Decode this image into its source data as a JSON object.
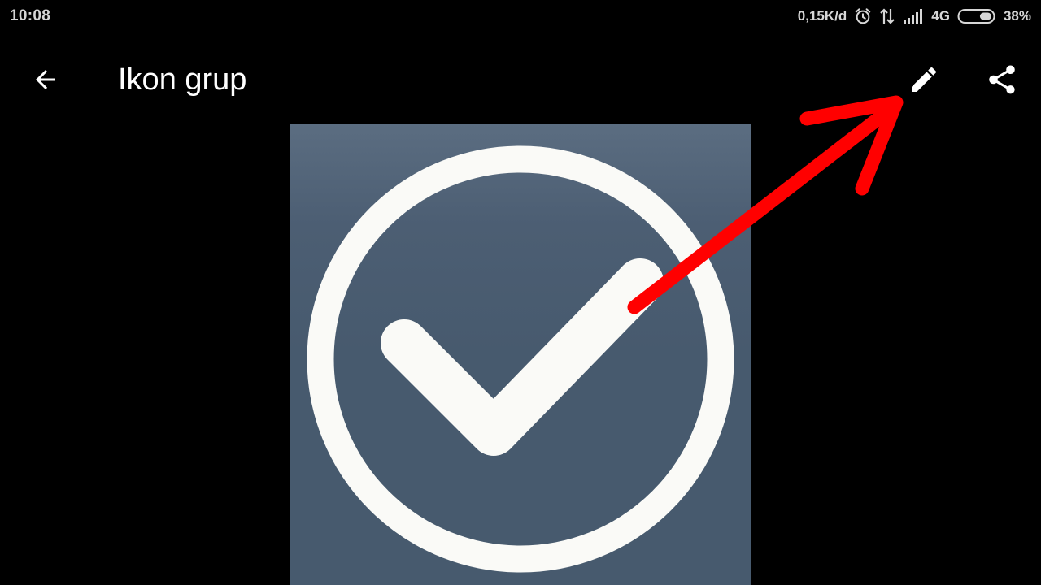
{
  "status_bar": {
    "time": "10:08",
    "network_speed": "0,15K/d",
    "network_type": "4G",
    "battery_percent": "38%",
    "battery_level": 0.38,
    "icons": [
      "alarm-icon",
      "data-transfer-icon",
      "signal-icon",
      "battery-icon"
    ]
  },
  "app_bar": {
    "title": "Ikon grup",
    "back_icon": "arrow-back-icon",
    "actions": [
      "pencil-edit-icon",
      "share-icon"
    ]
  },
  "image": {
    "content": "check-circle-icon",
    "background_color": "#475a6e",
    "foreground_color": "#fafaf7"
  },
  "annotation": {
    "type": "arrow",
    "color": "#ff0000",
    "points_to": "edit-button"
  }
}
